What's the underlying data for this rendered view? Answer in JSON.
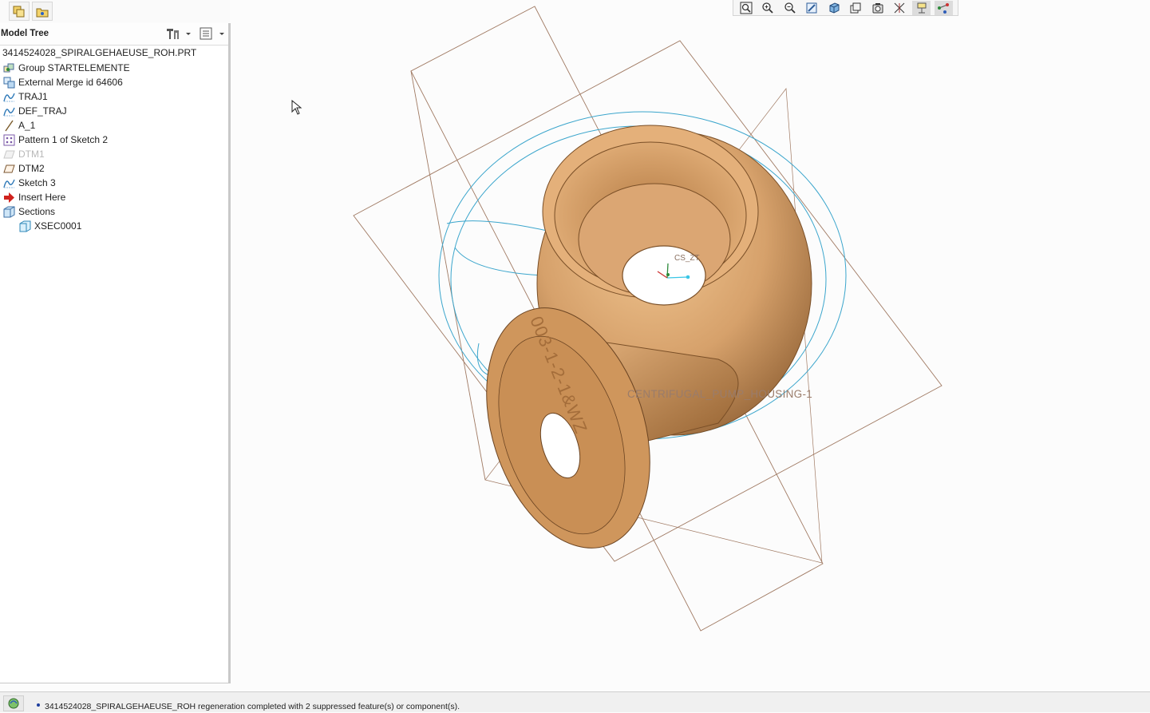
{
  "toolbar_left": {
    "buttons": [
      {
        "icon": "copy-layers-icon"
      },
      {
        "icon": "folder-star-icon"
      }
    ]
  },
  "model_tree": {
    "title": "Model Tree",
    "header_icons": [
      "tree-settings-icon",
      "tree-columns-icon"
    ],
    "root": "3414524028_SPIRALGEHAEUSE_ROH.PRT",
    "items": [
      {
        "label": "Group STARTELEMENTE",
        "icon": "group-icon"
      },
      {
        "label": "External Merge id 64606",
        "icon": "merge-icon"
      },
      {
        "label": "TRAJ1",
        "icon": "sketch-icon"
      },
      {
        "label": "DEF_TRAJ",
        "icon": "sketch-icon"
      },
      {
        "label": "A_1",
        "icon": "axis-icon"
      },
      {
        "label": "Pattern 1 of Sketch 2",
        "icon": "pattern-icon"
      },
      {
        "label": "DTM1",
        "icon": "datum-plane-icon",
        "suppressed": true
      },
      {
        "label": "DTM2",
        "icon": "datum-plane-icon"
      },
      {
        "label": "Sketch 3",
        "icon": "sketch-icon"
      },
      {
        "label": "Insert Here",
        "icon": "insert-arrow-icon"
      },
      {
        "label": "Sections",
        "icon": "sections-icon"
      },
      {
        "label": "XSEC0001",
        "icon": "xsec-icon",
        "child": true
      }
    ]
  },
  "view_toolbar": {
    "buttons": [
      "refit-icon",
      "zoom-in-icon",
      "zoom-out-icon",
      "repaint-icon",
      "display-style-icon",
      "saved-views-icon",
      "view-manager-icon",
      "perspective-icon",
      "annotation-display-icon",
      "spin-center-icon"
    ]
  },
  "graphics": {
    "model_label": "CENTRIFUGAL_PUMP_HOUSING-1",
    "coordsys_label": "CS_ZT",
    "flange_text": "003-1-2-1&WZ"
  },
  "status_bar": {
    "message": "3414524028_SPIRALGEHAEUSE_ROH regeneration completed with 2 suppressed feature(s) or component(s).",
    "icon": "regenerate-icon"
  },
  "colors": {
    "part_body": "#d6a16b",
    "datum_plane": "#a07a63",
    "curve": "#3aa5cc",
    "status_dot": "#1d3e9e"
  }
}
